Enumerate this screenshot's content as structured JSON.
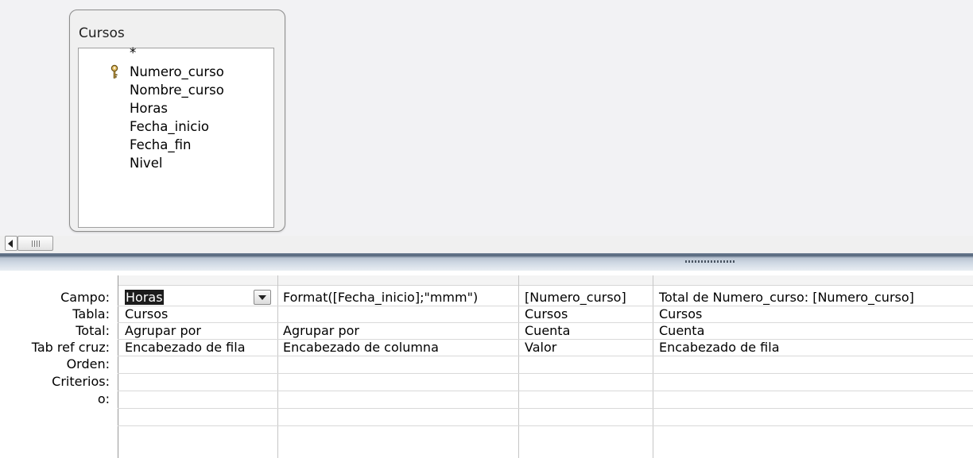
{
  "table": {
    "title": "Cursos",
    "fields": [
      "*",
      "Numero_curso",
      "Nombre_curso",
      "Horas",
      "Fecha_inicio",
      "Fecha_fin",
      "Nivel"
    ],
    "primary_key_field": "Numero_curso"
  },
  "grid": {
    "row_labels": {
      "campo": "Campo:",
      "tabla": "Tabla:",
      "total": "Total:",
      "tab_ref_cruz": "Tab ref cruz:",
      "orden": "Orden:",
      "criterios": "Criterios:",
      "o": "o:"
    },
    "columns": [
      {
        "campo": "Horas",
        "tabla": "Cursos",
        "total": "Agrupar por",
        "tab_ref_cruz": "Encabezado de fila",
        "orden": "",
        "criterios": "",
        "o": ""
      },
      {
        "campo": "Format([Fecha_inicio];\"mmm\")",
        "tabla": "",
        "total": "Agrupar por",
        "tab_ref_cruz": "Encabezado de columna",
        "orden": "",
        "criterios": "",
        "o": ""
      },
      {
        "campo": "[Numero_curso]",
        "tabla": "Cursos",
        "total": "Cuenta",
        "tab_ref_cruz": "Valor",
        "orden": "",
        "criterios": "",
        "o": ""
      },
      {
        "campo": "Total de Numero_curso: [Numero_curso]",
        "tabla": "Cursos",
        "total": "Cuenta",
        "tab_ref_cruz": "Encabezado de fila",
        "orden": "",
        "criterios": "",
        "o": ""
      }
    ]
  },
  "colors": {
    "upper_background": "#f2f2f4",
    "splitter": "#53647a",
    "grid_line": "#d9d9d9"
  }
}
